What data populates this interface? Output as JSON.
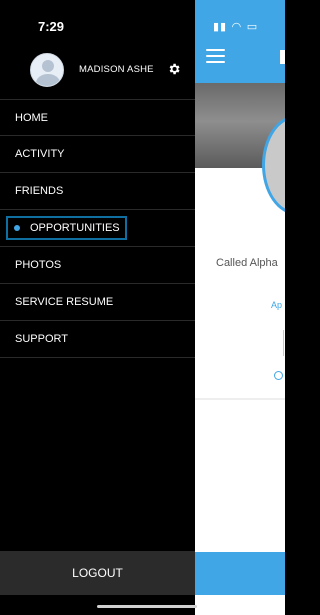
{
  "status_bar": {
    "time": "7:29"
  },
  "profile": {
    "name": "MADISON ASHE"
  },
  "menu": {
    "items": [
      {
        "label": "HOME",
        "active": false
      },
      {
        "label": "ACTIVITY",
        "active": false
      },
      {
        "label": "FRIENDS",
        "active": false
      },
      {
        "label": "OPPORTUNITIES",
        "active": true
      },
      {
        "label": "PHOTOS",
        "active": false
      },
      {
        "label": "SERVICE RESUME",
        "active": false
      },
      {
        "label": "SUPPORT",
        "active": false
      }
    ]
  },
  "logout_label": "LOGOUT",
  "background_screen": {
    "called_text": "Called Alpha",
    "link_text": "Ap"
  },
  "colors": {
    "accent": "#41a6e6",
    "active_outline": "#0e6fa0",
    "drawer_bg": "#000000",
    "logout_bg": "#2b2b2b"
  },
  "icons": {
    "avatar": "default-avatar-icon",
    "settings": "gear-icon",
    "menu": "hamburger-menu-icon",
    "active_marker": "bullet-dot-icon"
  }
}
